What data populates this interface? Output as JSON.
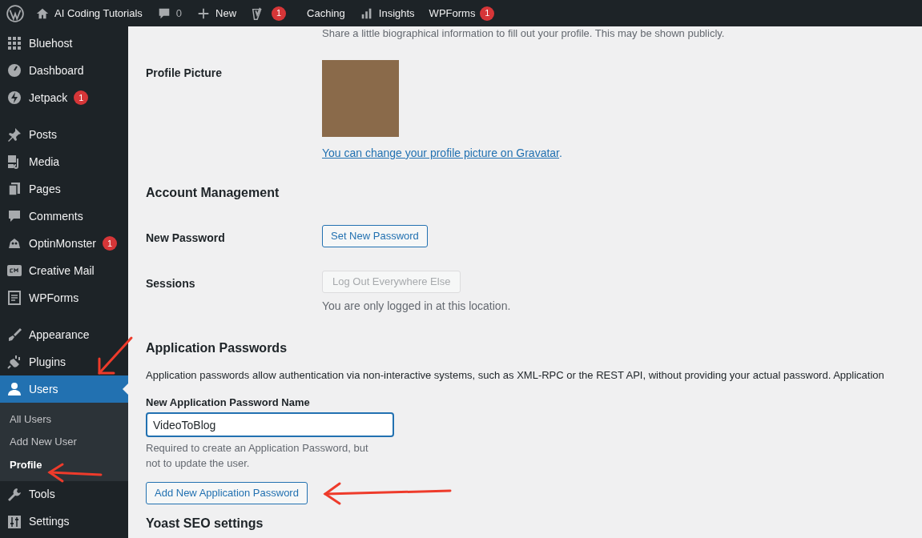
{
  "admin_bar": {
    "site_name": "AI Coding Tutorials",
    "comments_count": "0",
    "new_label": "New",
    "yoast_badge": "1",
    "items": [
      {
        "kind": "text",
        "label": "Caching"
      },
      {
        "kind": "chart",
        "label": "Insights"
      },
      {
        "kind": "text",
        "label": "WPForms",
        "badge": "1"
      }
    ]
  },
  "sidebar": {
    "groups": [
      [
        {
          "label": "Bluehost",
          "selected": false
        },
        {
          "label": "Dashboard",
          "selected": false
        },
        {
          "label": "Jetpack",
          "badge": "1",
          "selected": false
        }
      ],
      [
        {
          "label": "Posts",
          "selected": false
        },
        {
          "label": "Media",
          "selected": false
        },
        {
          "label": "Pages",
          "selected": false
        },
        {
          "label": "Comments",
          "selected": false
        },
        {
          "label": "OptinMonster",
          "badge": "1",
          "selected": false
        },
        {
          "label": "Creative Mail",
          "selected": false
        },
        {
          "label": "WPForms",
          "selected": false
        }
      ],
      [
        {
          "label": "Appearance",
          "selected": false
        },
        {
          "label": "Plugins",
          "selected": false
        },
        {
          "label": "Users",
          "selected": true,
          "children": [
            {
              "label": "All Users",
              "selected": false
            },
            {
              "label": "Add New User",
              "selected": false
            },
            {
              "label": "Profile",
              "selected": true
            }
          ]
        },
        {
          "label": "Tools",
          "selected": false
        },
        {
          "label": "Settings",
          "selected": false
        }
      ]
    ]
  },
  "content": {
    "bio_hint": "Share a little biographical information to fill out your profile. This may be shown publicly.",
    "profile_picture": {
      "label": "Profile Picture",
      "link": "You can change your profile picture on Gravatar",
      "after": "."
    },
    "account_management": {
      "heading": "Account Management",
      "rows": [
        {
          "label": "New Password",
          "button": "Set New Password",
          "disabled": false
        },
        {
          "label": "Sessions",
          "button": "Log Out Everywhere Else",
          "disabled": true,
          "note": "You are only logged in at this location."
        }
      ]
    },
    "application_passwords": {
      "heading": "Application Passwords",
      "description": "Application passwords allow authentication via non-interactive systems, such as XML-RPC or the REST API, without providing your actual password. Application",
      "field_label": "New Application Password Name",
      "value": "VideoToBlog",
      "hint": "Required to create an Application Password, but not to update the user.",
      "button": "Add New Application Password"
    },
    "next_heading": "Yoast SEO settings"
  }
}
